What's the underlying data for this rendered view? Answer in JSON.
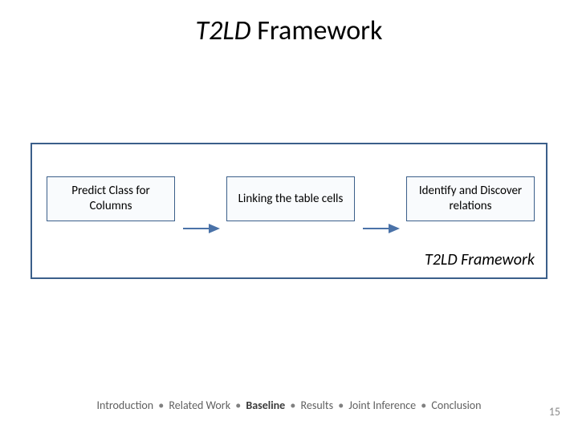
{
  "title": {
    "ital": "T2LD",
    "rest": " Framework"
  },
  "framework": {
    "stages": [
      {
        "label": "Predict Class for Columns"
      },
      {
        "label": "Linking the table cells"
      },
      {
        "label": "Identify and Discover relations"
      }
    ],
    "caption": "T2LD Framework"
  },
  "breadcrumb": {
    "items": [
      {
        "label": "Introduction",
        "bold": false
      },
      {
        "label": "Related Work",
        "bold": false
      },
      {
        "label": "Baseline",
        "bold": true
      },
      {
        "label": "Results",
        "bold": false
      },
      {
        "label": "Joint Inference",
        "bold": false
      },
      {
        "label": "Conclusion",
        "bold": false
      }
    ],
    "separator": "•"
  },
  "page_number": "15",
  "colors": {
    "border": "#3b5f8a",
    "arrow": "#4a72a8"
  }
}
